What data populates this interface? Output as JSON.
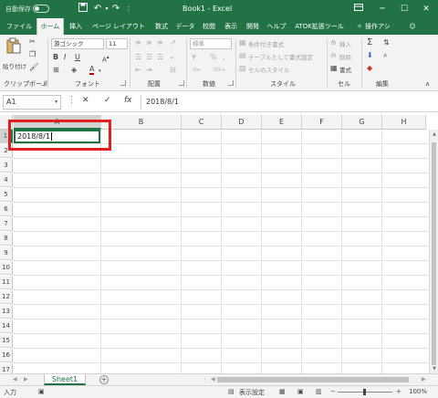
{
  "titlebar": {
    "autosave_label": "自動保存",
    "autosave_state": "オフ",
    "title": "Book1 - Excel",
    "qat": {
      "save_icon": "save-icon",
      "undo_icon": "undo-icon",
      "redo_icon": "redo-icon",
      "customize_icon": "chevron-down-icon"
    },
    "window_buttons": [
      "ribbon-display-icon",
      "minimize-icon",
      "maximize-icon",
      "close-icon"
    ]
  },
  "tabs": [
    {
      "label": "ファイル"
    },
    {
      "label": "ホーム",
      "active": true
    },
    {
      "label": "挿入"
    },
    {
      "label": "ページ レイアウト"
    },
    {
      "label": "数式"
    },
    {
      "label": "データ"
    },
    {
      "label": "校閲"
    },
    {
      "label": "表示"
    },
    {
      "label": "開発"
    },
    {
      "label": "ヘルプ"
    },
    {
      "label": "ATOK拡張ツール"
    }
  ],
  "tell_me": "操作アシ",
  "ribbon": {
    "clipboard": {
      "paste_label": "貼り付け",
      "group_label": "クリップボード"
    },
    "font": {
      "font_name": "游ゴシック",
      "font_size": "11",
      "bold": "B",
      "italic": "I",
      "underline": "U",
      "font_color_letter": "A",
      "group_label": "フォント",
      "font_color": "#c00000"
    },
    "alignment": {
      "group_label": "配置"
    },
    "number": {
      "format": "標準",
      "percent": "%",
      "comma": ",",
      "currency": "¥",
      "group_label": "数値"
    },
    "styles": {
      "conditional": "条件付き書式",
      "table": "テーブルとして書式設定",
      "cell_styles": "セルのスタイル",
      "group_label": "スタイル"
    },
    "cells": {
      "insert": "挿入",
      "delete": "削除",
      "format": "書式",
      "group_label": "セル"
    },
    "editing": {
      "sum": "Σ",
      "group_label": "編集"
    }
  },
  "formula_bar": {
    "name_box": "A1",
    "cancel_icon": "✕",
    "enter_icon": "✓",
    "fx_icon": "fx",
    "formula": "2018/8/1"
  },
  "grid": {
    "columns": [
      "A",
      "B",
      "C",
      "D",
      "E",
      "F",
      "G",
      "H"
    ],
    "selected_column": "A",
    "rows": [
      "1",
      "2",
      "3",
      "4",
      "5",
      "6",
      "7",
      "8",
      "9",
      "10",
      "11",
      "12",
      "13",
      "14",
      "15",
      "16",
      "17"
    ],
    "selected_row": "1",
    "cell_a1": "2018/8/1",
    "highlight_color": "#e02020",
    "accent": "#217346"
  },
  "sheets": {
    "tabs": [
      "Sheet1"
    ],
    "add_icon": "+"
  },
  "status": {
    "mode": "入力",
    "display_settings": "表示設定",
    "zoom_minus": "−",
    "zoom_plus": "+",
    "zoom": "100%"
  }
}
